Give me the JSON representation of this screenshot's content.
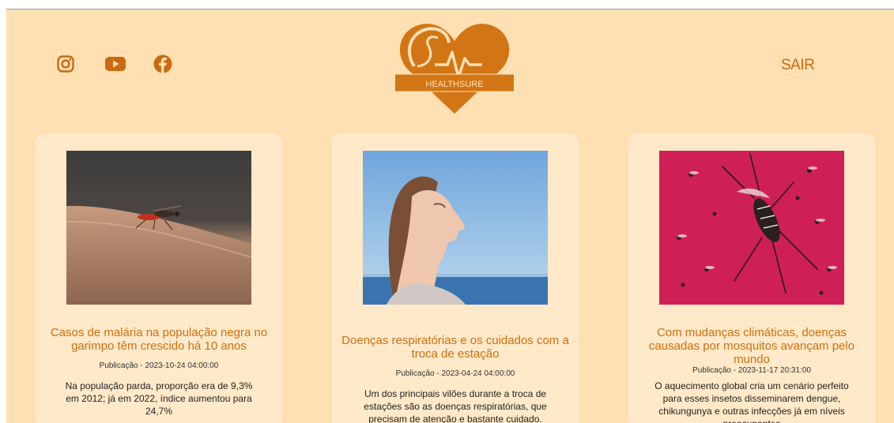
{
  "header": {
    "social": [
      {
        "name": "instagram"
      },
      {
        "name": "youtube"
      },
      {
        "name": "facebook"
      }
    ],
    "logo_text": "HEALTHSURE",
    "logout_label": "SAIR"
  },
  "colors": {
    "background": "#ffe0b2",
    "card": "#ffe9c8",
    "accent": "#c96a10",
    "title": "#cf6f12"
  },
  "articles": [
    {
      "title": "Casos de malária na população negra no garimpo têm crescido há 10 anos",
      "date": "Publicação - 2023-10-24 04:00:00",
      "summary": "Na população parda, proporção era de 9,3% em 2012; já em 2022, índice aumentou para 24,7%"
    },
    {
      "title": "Doenças respiratórias e os cuidados com a troca de estação",
      "date": "Publicação - 2023-04-24 04:00:00",
      "summary": "Um dos principais vilões durante a troca de estações são as doenças respiratórias, que precisam de atenção e bastante cuidado."
    },
    {
      "title": "Com mudanças climáticas, doenças causadas por mosquitos avançam pelo mundo",
      "date": "Publicação - 2023-11-17 20:31:00",
      "summary": "O aquecimento global cria um cenário perfeito para esses insetos disseminarem dengue, chikungunya e outras infecções já em níveis preocupantes"
    }
  ]
}
